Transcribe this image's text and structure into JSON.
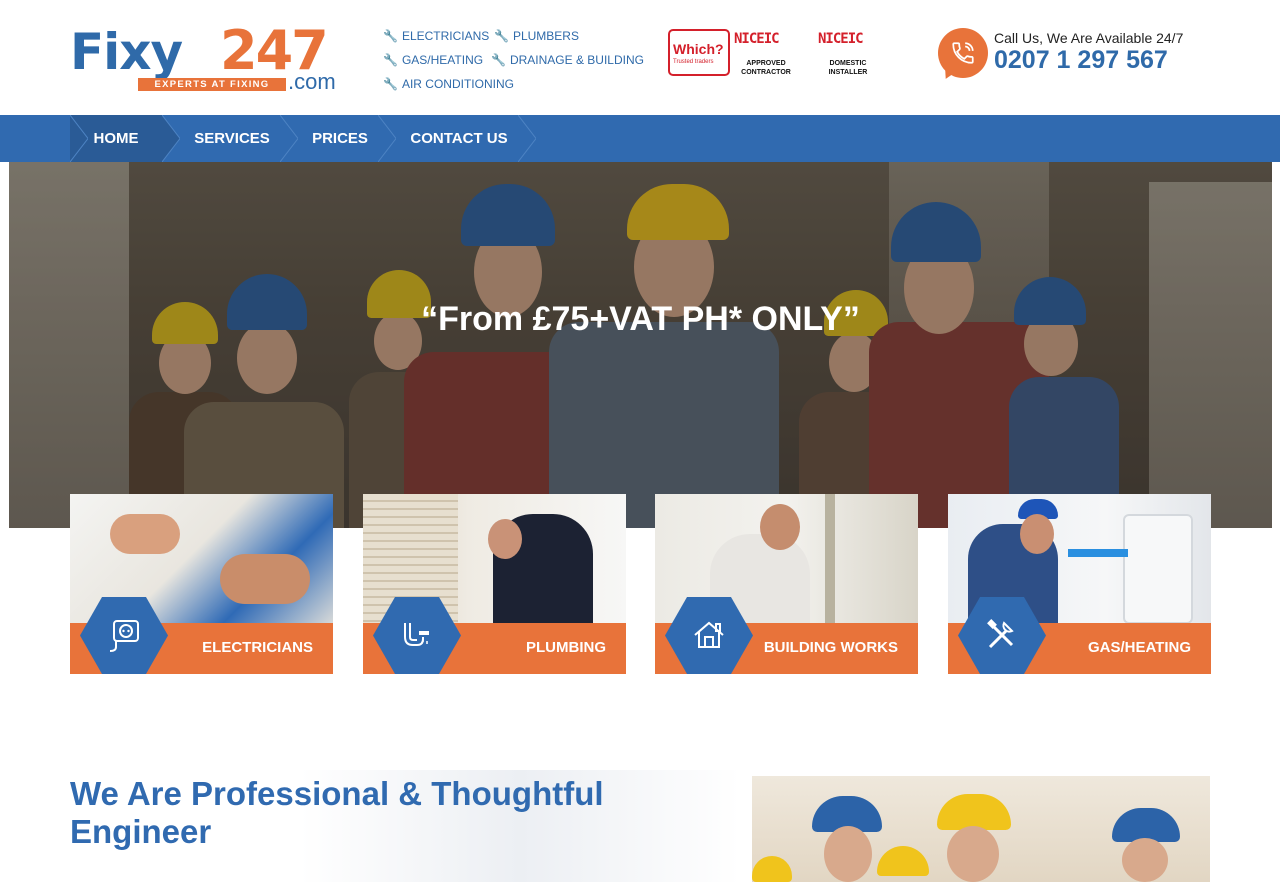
{
  "header": {
    "logo": {
      "name": "Fixy",
      "number": "247",
      "tagline": "EXPERTS AT FIXING",
      "suffix": ".com"
    },
    "service_links": [
      {
        "label": "ELECTRICIANS",
        "icon": "wrench-icon"
      },
      {
        "label": "PLUMBERS",
        "icon": "wrench-icon"
      },
      {
        "label": "GAS/HEATING",
        "icon": "wrench-icon"
      },
      {
        "label": "DRAINAGE & BUILDING",
        "icon": "wrench-icon"
      },
      {
        "label": "AIR CONDITIONING",
        "icon": "wrench-icon"
      }
    ],
    "badges": {
      "which": {
        "title": "Which?",
        "subtitle": "Trusted traders"
      },
      "niceic_approved": {
        "logo": "NICEIC",
        "caption": "APPROVED CONTRACTOR"
      },
      "niceic_domestic": {
        "logo": "NICEIC",
        "caption": "DOMESTIC INSTALLER"
      }
    },
    "call": {
      "label": "Call Us, We Are Available 24/7",
      "number": "0207 1 297 567",
      "icon": "phone-icon"
    }
  },
  "nav": {
    "items": [
      {
        "label": "HOME",
        "active": true
      },
      {
        "label": "SERVICES",
        "active": false
      },
      {
        "label": "PRICES",
        "active": false
      },
      {
        "label": "CONTACT US",
        "active": false
      }
    ]
  },
  "hero": {
    "headline": "“From £75+VAT PH* ONLY”"
  },
  "services": [
    {
      "label": "ELECTRICIANS",
      "icon": "socket-plug-icon"
    },
    {
      "label": "PLUMBING",
      "icon": "pipe-tap-icon"
    },
    {
      "label": "BUILDING WORKS",
      "icon": "house-icon"
    },
    {
      "label": "GAS/HEATING",
      "icon": "tools-icon"
    }
  ],
  "about": {
    "title": "We Are Professional & Thoughtful Engineer"
  },
  "colors": {
    "brand_blue": "#306ab0",
    "brand_orange": "#e8733a",
    "nav_active": "#2a5b96"
  }
}
